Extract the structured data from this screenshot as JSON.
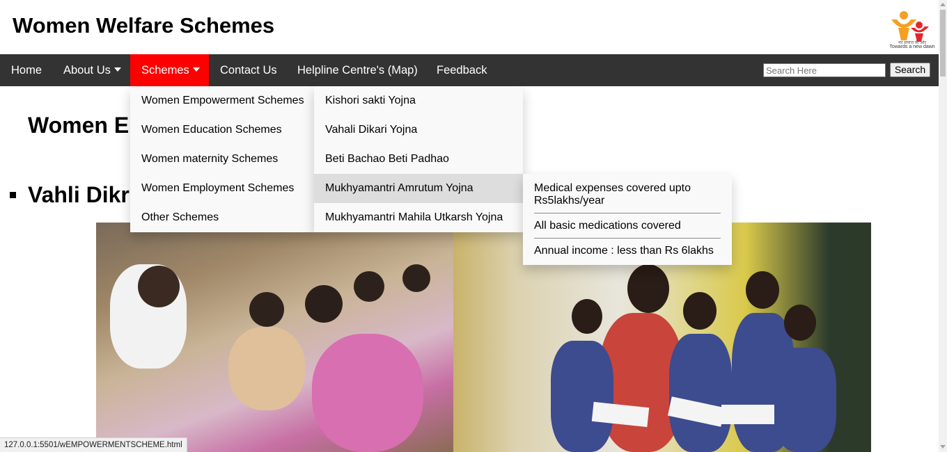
{
  "header": {
    "title": "Women Welfare Schemes",
    "logo": {
      "icon": "person-family-logo-icon",
      "hindi_tagline": "नए समाज की ओर",
      "tagline": "Towards a new dawn"
    }
  },
  "navbar": {
    "items": [
      {
        "label": "Home"
      },
      {
        "label": "About Us"
      },
      {
        "label": "Schemes"
      },
      {
        "label": "Contact Us"
      },
      {
        "label": "Helpline Centre's (Map)"
      },
      {
        "label": "Feedback"
      }
    ],
    "active_color": "#ff0000",
    "background_color": "#333333"
  },
  "search": {
    "placeholder": "Search Here",
    "value": "",
    "button_label": "Search"
  },
  "main": {
    "heading": "Women E",
    "subheading": "Vahli Dikr"
  },
  "schemes_menu": {
    "items": [
      {
        "label": "Women Empowerment Schemes"
      },
      {
        "label": "Women Education Schemes"
      },
      {
        "label": "Women maternity Schemes"
      },
      {
        "label": "Women Employment Schemes"
      },
      {
        "label": "Other Schemes"
      }
    ]
  },
  "empowerment_menu": {
    "items": [
      {
        "label": "Kishori sakti Yojna"
      },
      {
        "label": "Vahali Dikari Yojna"
      },
      {
        "label": "Beti Bachao Beti Padhao"
      },
      {
        "label": "Mukhyamantri Amrutum Yojna"
      },
      {
        "label": "Mukhyamantri Mahila Utkarsh Yojna"
      }
    ]
  },
  "scheme_details": {
    "lines": [
      "Medical expenses covered upto Rs5lakhs/year",
      "All basic medications covered",
      "Annual income : less than Rs 6lakhs"
    ]
  },
  "status_bar": {
    "url": "127.0.0.1:5501/wEMPOWERMENTSCHEME.html"
  }
}
